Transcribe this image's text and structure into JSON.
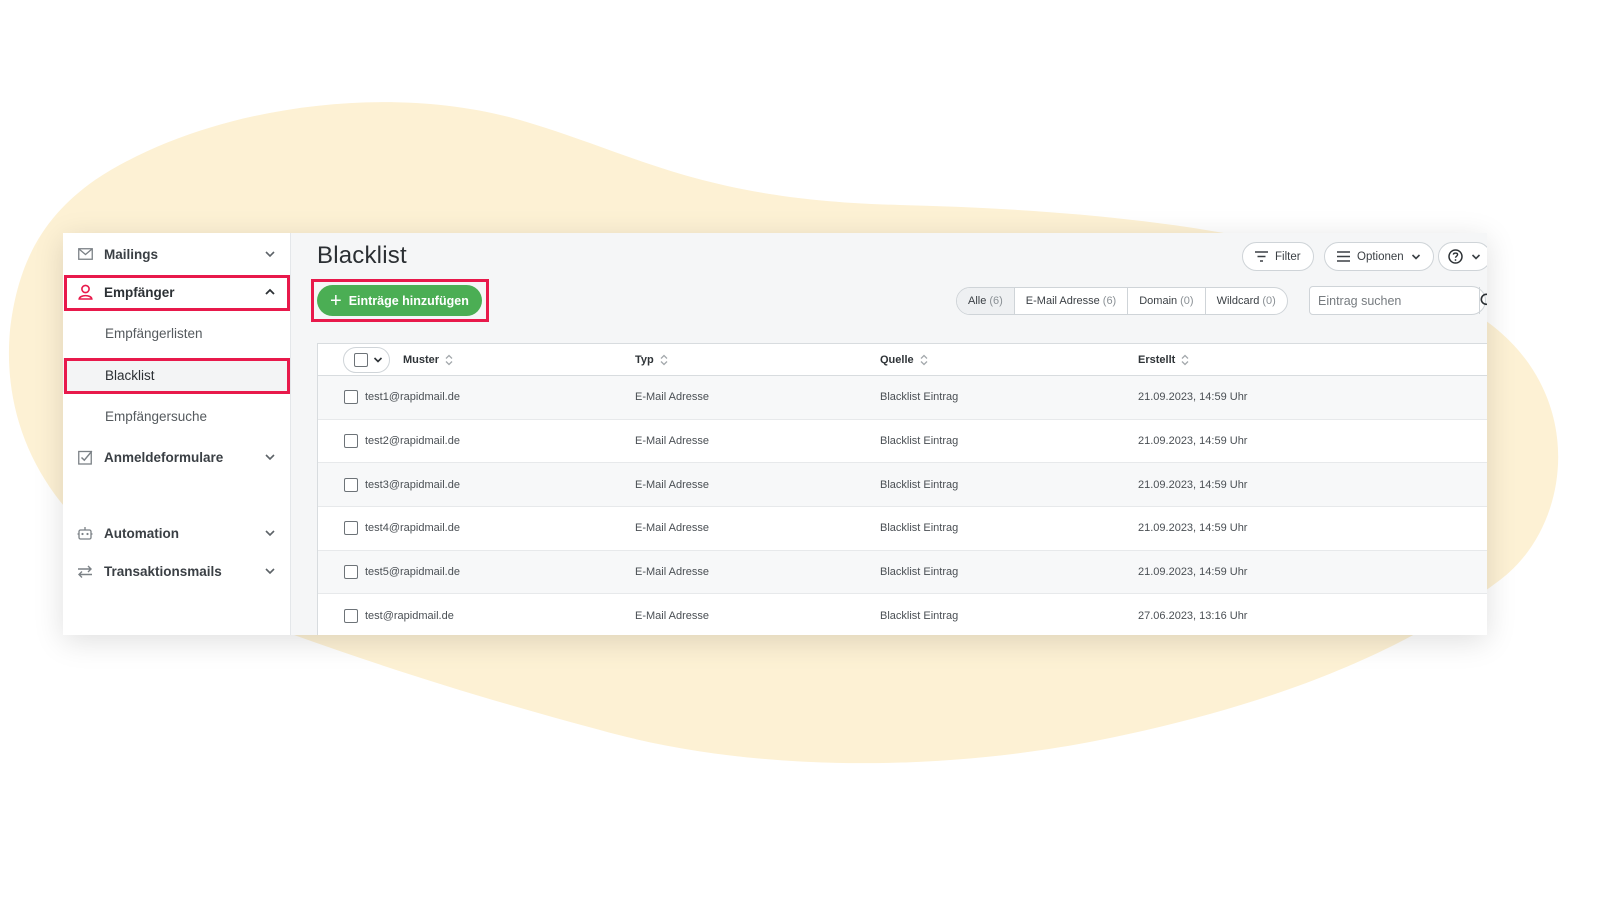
{
  "sidebar": {
    "items": [
      {
        "label": "Mailings",
        "icon": "mail-icon"
      },
      {
        "label": "Empfänger",
        "icon": "user-icon",
        "active": true
      },
      {
        "label": "Anmeldeformulare",
        "icon": "checkbox-form-icon"
      },
      {
        "label": "Automation",
        "icon": "robot-icon"
      },
      {
        "label": "Transaktionsmails",
        "icon": "transfer-arrows-icon"
      }
    ],
    "subitems": [
      {
        "label": "Empfängerlisten"
      },
      {
        "label": "Blacklist",
        "active": true
      },
      {
        "label": "Empfängersuche"
      }
    ]
  },
  "header": {
    "title": "Blacklist",
    "filter_label": "Filter",
    "options_label": "Optionen",
    "help_icon": "help-circle-icon"
  },
  "toolbar": {
    "add_label": "Einträge hinzufügen",
    "segments": [
      {
        "label": "Alle",
        "count": "(6)",
        "active": true
      },
      {
        "label": "E-Mail Adresse",
        "count": "(6)"
      },
      {
        "label": "Domain",
        "count": "(0)"
      },
      {
        "label": "Wildcard",
        "count": "(0)"
      }
    ],
    "search_placeholder": "Eintrag suchen"
  },
  "table": {
    "columns": [
      "Muster",
      "Typ",
      "Quelle",
      "Erstellt"
    ],
    "rows": [
      {
        "muster": "test1@rapidmail.de",
        "typ": "E-Mail Adresse",
        "quelle": "Blacklist Eintrag",
        "erstellt": "21.09.2023, 14:59 Uhr"
      },
      {
        "muster": "test2@rapidmail.de",
        "typ": "E-Mail Adresse",
        "quelle": "Blacklist Eintrag",
        "erstellt": "21.09.2023, 14:59 Uhr"
      },
      {
        "muster": "test3@rapidmail.de",
        "typ": "E-Mail Adresse",
        "quelle": "Blacklist Eintrag",
        "erstellt": "21.09.2023, 14:59 Uhr"
      },
      {
        "muster": "test4@rapidmail.de",
        "typ": "E-Mail Adresse",
        "quelle": "Blacklist Eintrag",
        "erstellt": "21.09.2023, 14:59 Uhr"
      },
      {
        "muster": "test5@rapidmail.de",
        "typ": "E-Mail Adresse",
        "quelle": "Blacklist Eintrag",
        "erstellt": "21.09.2023, 14:59 Uhr"
      },
      {
        "muster": "test@rapidmail.de",
        "typ": "E-Mail Adresse",
        "quelle": "Blacklist Eintrag",
        "erstellt": "27.06.2023, 13:16 Uhr"
      }
    ]
  },
  "colors": {
    "accent_green": "#4bae54",
    "highlight_red": "#e8194b",
    "background_blob": "#fdf1d4"
  }
}
